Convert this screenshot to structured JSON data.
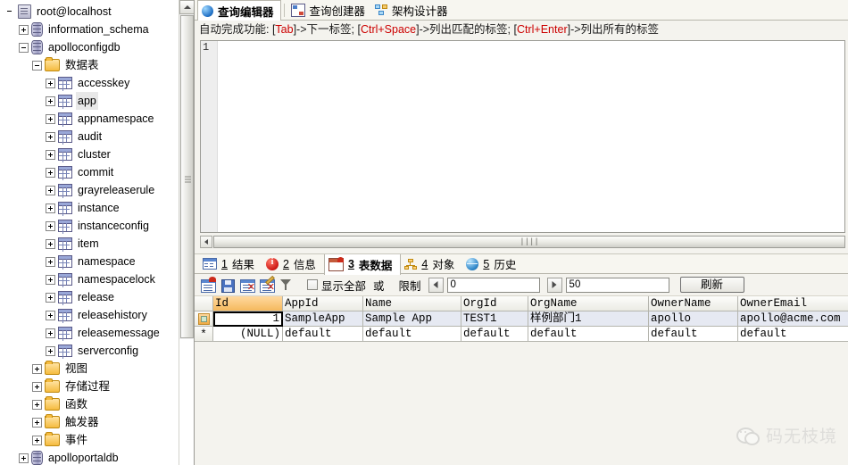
{
  "sidebar": {
    "tree": [
      {
        "label": "root@localhost",
        "indent": 0,
        "expander": "none",
        "icon": "server-icon",
        "selected": false
      },
      {
        "label": "information_schema",
        "indent": 1,
        "expander": "plus",
        "icon": "database-icon",
        "selected": false
      },
      {
        "label": "apolloconfigdb",
        "indent": 1,
        "expander": "minus",
        "icon": "database-icon",
        "selected": false
      },
      {
        "label": "数据表",
        "indent": 2,
        "expander": "minus",
        "icon": "folder-icon",
        "selected": false
      },
      {
        "label": "accesskey",
        "indent": 3,
        "expander": "plus",
        "icon": "table-icon",
        "selected": false
      },
      {
        "label": "app",
        "indent": 3,
        "expander": "plus",
        "icon": "table-icon",
        "selected": true
      },
      {
        "label": "appnamespace",
        "indent": 3,
        "expander": "plus",
        "icon": "table-icon",
        "selected": false
      },
      {
        "label": "audit",
        "indent": 3,
        "expander": "plus",
        "icon": "table-icon",
        "selected": false
      },
      {
        "label": "cluster",
        "indent": 3,
        "expander": "plus",
        "icon": "table-icon",
        "selected": false
      },
      {
        "label": "commit",
        "indent": 3,
        "expander": "plus",
        "icon": "table-icon",
        "selected": false
      },
      {
        "label": "grayreleaserule",
        "indent": 3,
        "expander": "plus",
        "icon": "table-icon",
        "selected": false
      },
      {
        "label": "instance",
        "indent": 3,
        "expander": "plus",
        "icon": "table-icon",
        "selected": false
      },
      {
        "label": "instanceconfig",
        "indent": 3,
        "expander": "plus",
        "icon": "table-icon",
        "selected": false
      },
      {
        "label": "item",
        "indent": 3,
        "expander": "plus",
        "icon": "table-icon",
        "selected": false
      },
      {
        "label": "namespace",
        "indent": 3,
        "expander": "plus",
        "icon": "table-icon",
        "selected": false
      },
      {
        "label": "namespacelock",
        "indent": 3,
        "expander": "plus",
        "icon": "table-icon",
        "selected": false
      },
      {
        "label": "release",
        "indent": 3,
        "expander": "plus",
        "icon": "table-icon",
        "selected": false
      },
      {
        "label": "releasehistory",
        "indent": 3,
        "expander": "plus",
        "icon": "table-icon",
        "selected": false
      },
      {
        "label": "releasemessage",
        "indent": 3,
        "expander": "plus",
        "icon": "table-icon",
        "selected": false
      },
      {
        "label": "serverconfig",
        "indent": 3,
        "expander": "plus",
        "icon": "table-icon",
        "selected": false
      },
      {
        "label": "视图",
        "indent": 2,
        "expander": "plus",
        "icon": "folder-icon",
        "selected": false
      },
      {
        "label": "存储过程",
        "indent": 2,
        "expander": "plus",
        "icon": "folder-icon",
        "selected": false
      },
      {
        "label": "函数",
        "indent": 2,
        "expander": "plus",
        "icon": "folder-icon",
        "selected": false
      },
      {
        "label": "触发器",
        "indent": 2,
        "expander": "plus",
        "icon": "folder-icon",
        "selected": false
      },
      {
        "label": "事件",
        "indent": 2,
        "expander": "plus",
        "icon": "folder-icon",
        "selected": false
      },
      {
        "label": "apolloportaldb",
        "indent": 1,
        "expander": "plus",
        "icon": "database-icon",
        "selected": false
      }
    ]
  },
  "tabs": [
    {
      "label": "查询编辑器",
      "icon": "globe-icon",
      "active": true
    },
    {
      "label": "查询创建器",
      "icon": "query-builder-icon",
      "active": false
    },
    {
      "label": "架构设计器",
      "icon": "schema-designer-icon",
      "active": false
    }
  ],
  "hint": {
    "p1": "自动完成功能: [",
    "k1": "Tab",
    "p2": "]->下一标签; [",
    "k2": "Ctrl+Space",
    "p3": "]->列出匹配的标签; [",
    "k3": "Ctrl+Enter",
    "p4": "]->列出所有的标签"
  },
  "editor": {
    "line_number": "1",
    "content": ""
  },
  "hscroll": {
    "grip": "||||"
  },
  "result_tabs": [
    {
      "num": "1",
      "label": "结果",
      "icon": "result-grid-icon",
      "active": false
    },
    {
      "num": "2",
      "label": "信息",
      "icon": "info-icon",
      "active": false
    },
    {
      "num": "3",
      "label": "表数据",
      "icon": "table-data-icon",
      "active": true
    },
    {
      "num": "4",
      "label": "对象",
      "icon": "objects-icon",
      "active": false
    },
    {
      "num": "5",
      "label": "历史",
      "icon": "history-icon",
      "active": false
    }
  ],
  "grid_toolbar": {
    "icons": [
      "open-table-icon",
      "save-icon",
      "delete-record-icon",
      "edit-delete-icon",
      "filter-icon"
    ],
    "show_all_label": "显示全部",
    "or_label": "或",
    "limit_label": "限制",
    "offset_value": "0",
    "count_value": "50",
    "refresh_label": "刷新"
  },
  "data_grid": {
    "columns": [
      "Id",
      "AppId",
      "Name",
      "OrgId",
      "OrgName",
      "OwnerName",
      "OwnerEmail"
    ],
    "widths": [
      78,
      90,
      110,
      75,
      135,
      100,
      140
    ],
    "rows": [
      {
        "type": "data",
        "marker": "selected",
        "cells": [
          "1",
          "SampleApp",
          "Sample App",
          "TEST1",
          "样例部门1",
          "apollo",
          "apollo@acme.com"
        ]
      },
      {
        "type": "new",
        "marker": "*",
        "cells": [
          "(NULL)",
          "default",
          "default",
          "default",
          "default",
          "default",
          "default"
        ]
      }
    ]
  },
  "watermark": {
    "text": "码无枝境",
    "logo": "wechat-icon"
  }
}
